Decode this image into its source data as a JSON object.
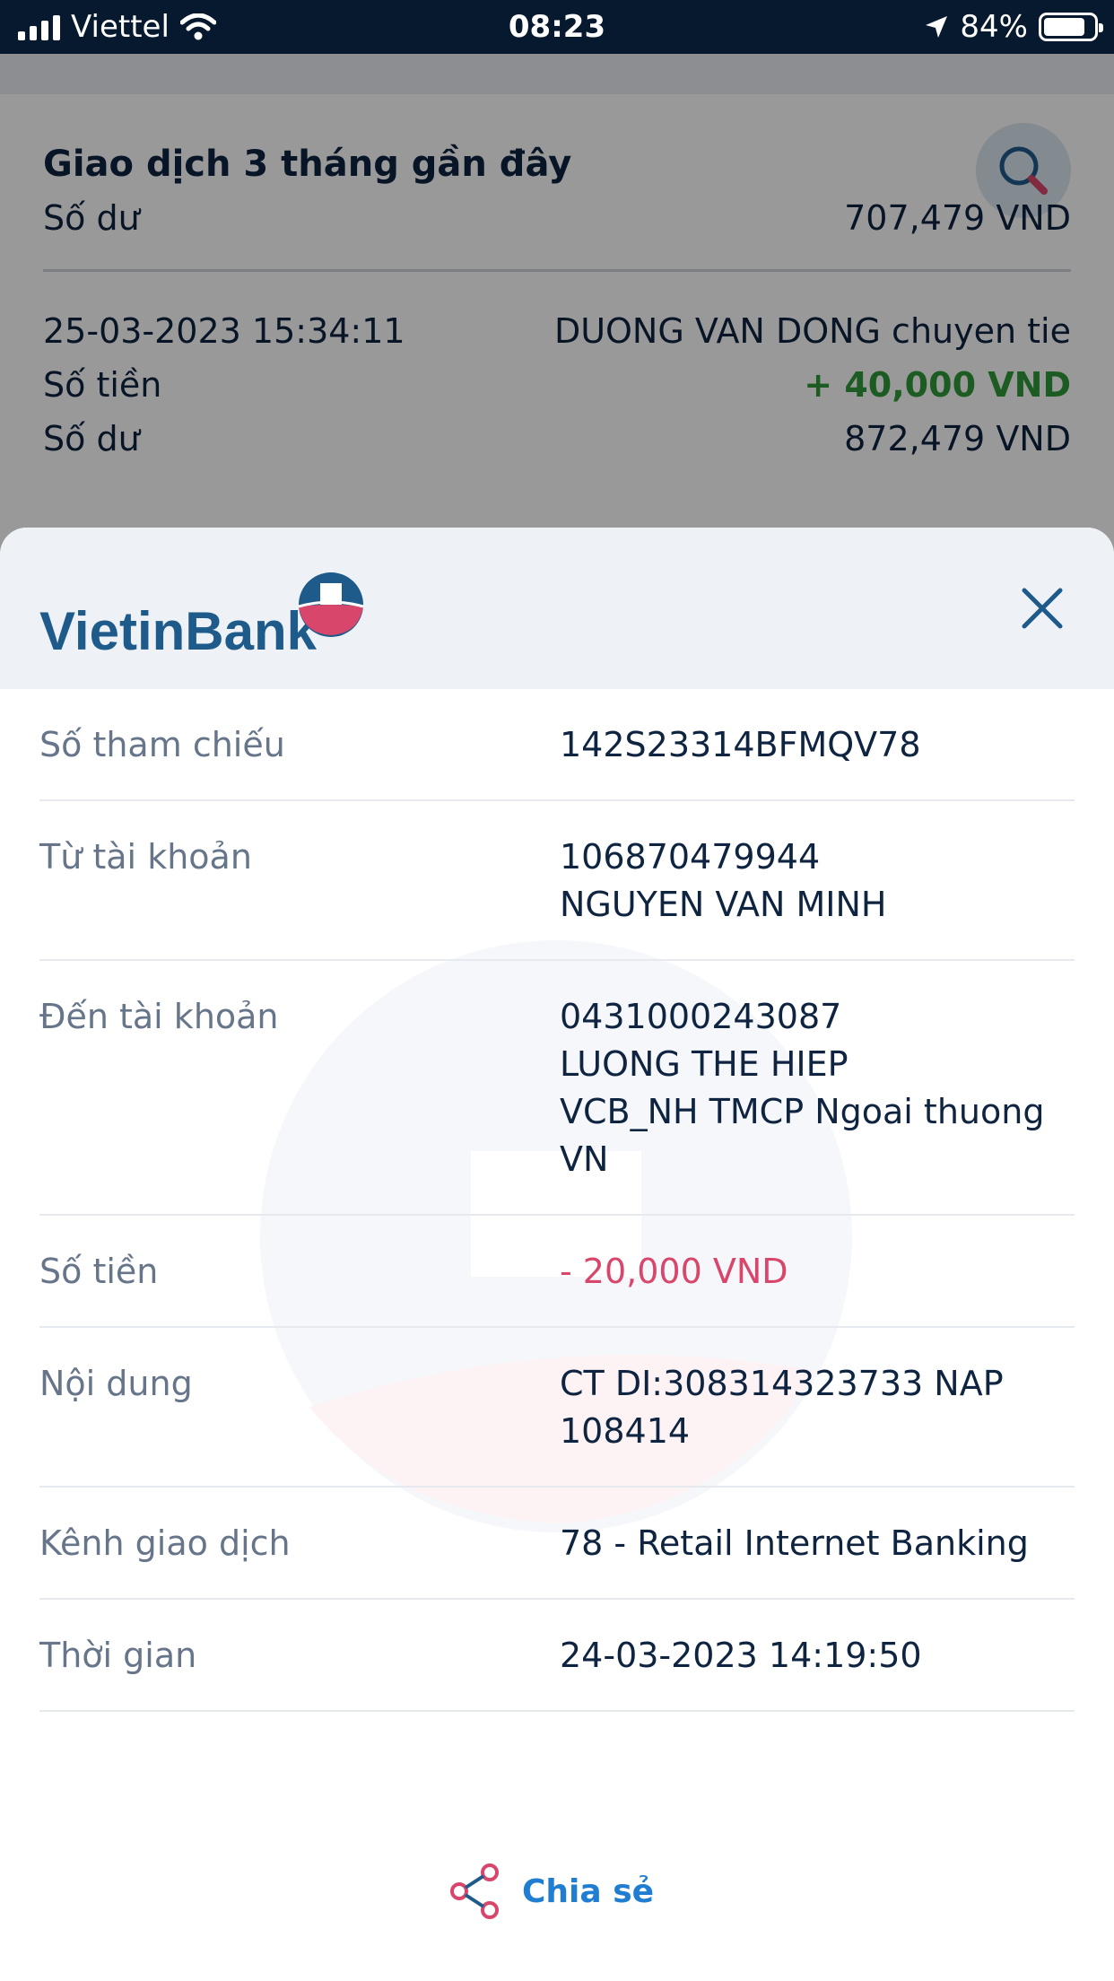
{
  "status_bar": {
    "carrier": "Viettel",
    "time": "08:23",
    "battery": "84%",
    "battery_level": 0.84
  },
  "background": {
    "title": "Giao dịch 3 tháng gần đây",
    "partial_row": {
      "label": "Số dư",
      "value": "707,479 VND"
    },
    "transaction": {
      "datetime": "25-03-2023 15:34:11",
      "description": "DUONG VAN DONG chuyen tie",
      "amount_label": "Số tiền",
      "amount": "+ 40,000 VND",
      "balance_label": "Số dư",
      "balance": "872,479 VND"
    }
  },
  "sheet": {
    "brand": "VietinBank",
    "rows": [
      {
        "label": "Số tham chiếu",
        "lines": [
          "142S23314BFMQV78"
        ]
      },
      {
        "label": "Từ tài khoản",
        "lines": [
          "106870479944",
          "NGUYEN VAN MINH"
        ]
      },
      {
        "label": "Đến tài khoản",
        "lines": [
          "0431000243087",
          "LUONG THE HIEP",
          "VCB_NH TMCP Ngoai thuong",
          "VN"
        ]
      },
      {
        "label": "Số tiền",
        "lines": [
          "- 20,000 VND"
        ]
      },
      {
        "label": "Nội dung",
        "lines": [
          "CT DI:308314323733 NAP",
          "108414"
        ]
      },
      {
        "label": "Kênh giao dịch",
        "lines": [
          "78 - Retail Internet Banking"
        ]
      },
      {
        "label": "Thời gian",
        "lines": [
          "24-03-2023 14:19:50"
        ]
      }
    ],
    "share_label": "Chia sẻ"
  },
  "colors": {
    "brand_blue": "#1e5a8a",
    "brand_red": "#d8466b",
    "positive": "#2f9a3a",
    "link": "#1f7ed1"
  }
}
